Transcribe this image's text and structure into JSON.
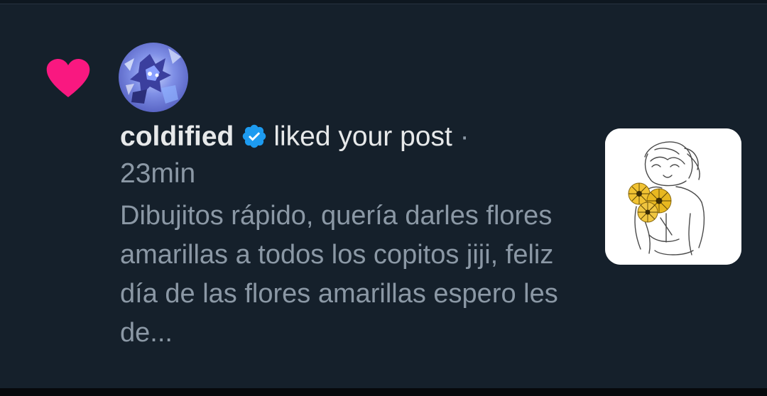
{
  "notification": {
    "icon": "heart-icon",
    "icon_color": "#f91880",
    "avatar": "user-avatar",
    "username": "coldified",
    "verified": "verified-badge-icon",
    "verified_color": "#1d9bf0",
    "action": "liked your post",
    "separator": "·",
    "time": "23min",
    "post_text": "Dibujitos rápido, quería darles flores amarillas a todos los copitos jiji, feliz día de las flores amarillas espero les de...",
    "thumbnail": "post-thumbnail-image"
  },
  "colors": {
    "background": "#15202b",
    "text_primary": "#e7e9ea",
    "text_secondary": "#8b98a5"
  }
}
